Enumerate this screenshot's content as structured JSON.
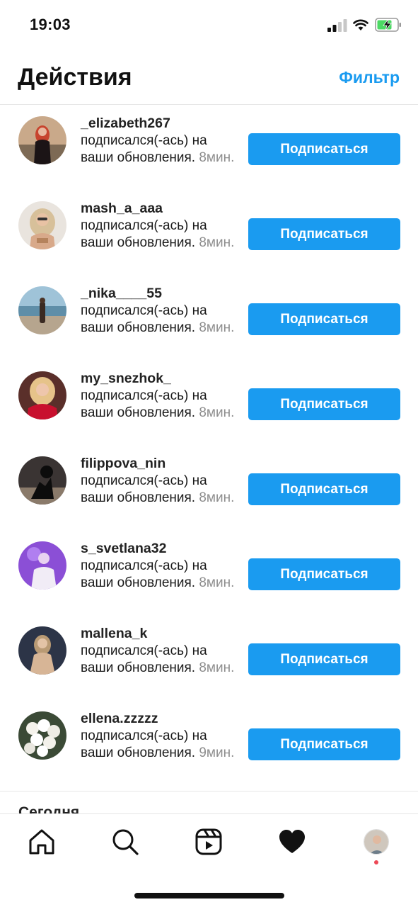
{
  "status_bar": {
    "time": "19:03"
  },
  "header": {
    "title": "Действия",
    "filter_label": "Фильтр"
  },
  "activity": [
    {
      "username": "_elizabeth267",
      "action": "подписался(-ась) на ваши обновления.",
      "time": "8мин.",
      "button": "Подписаться"
    },
    {
      "username": "mash_a_aaa",
      "action": "подписался(-ась) на ваши обновления.",
      "time": "8мин.",
      "button": "Подписаться"
    },
    {
      "username": "_nika____55",
      "action": "подписался(-ась) на ваши обновления.",
      "time": "8мин.",
      "button": "Подписаться"
    },
    {
      "username": "my_snezhok_",
      "action": "подписался(-ась) на ваши обновления.",
      "time": "8мин.",
      "button": "Подписаться"
    },
    {
      "username": "filippova_nin",
      "action": "подписался(-ась) на ваши обновления.",
      "time": "8мин.",
      "button": "Подписаться"
    },
    {
      "username": "s_svetlana32",
      "action": "подписался(-ась) на ваши обновления.",
      "time": "8мин.",
      "button": "Подписаться"
    },
    {
      "username": "mallena_k",
      "action": "подписался(-ась) на ваши обновления.",
      "time": "8мин.",
      "button": "Подписаться"
    },
    {
      "username": "ellena.zzzzz",
      "action": "подписался(-ась) на ваши обновления.",
      "time": "9мин.",
      "button": "Подписаться"
    }
  ],
  "section": {
    "title": "Сегодня"
  },
  "tabbar": {
    "tabs": [
      {
        "icon": "home-icon"
      },
      {
        "icon": "search-icon"
      },
      {
        "icon": "reels-icon"
      },
      {
        "icon": "heart-icon",
        "active": true
      },
      {
        "icon": "profile-avatar"
      }
    ]
  },
  "colors": {
    "accent": "#1a9bf0",
    "notification_dot": "#ed4956",
    "muted": "#8e8e8e"
  }
}
